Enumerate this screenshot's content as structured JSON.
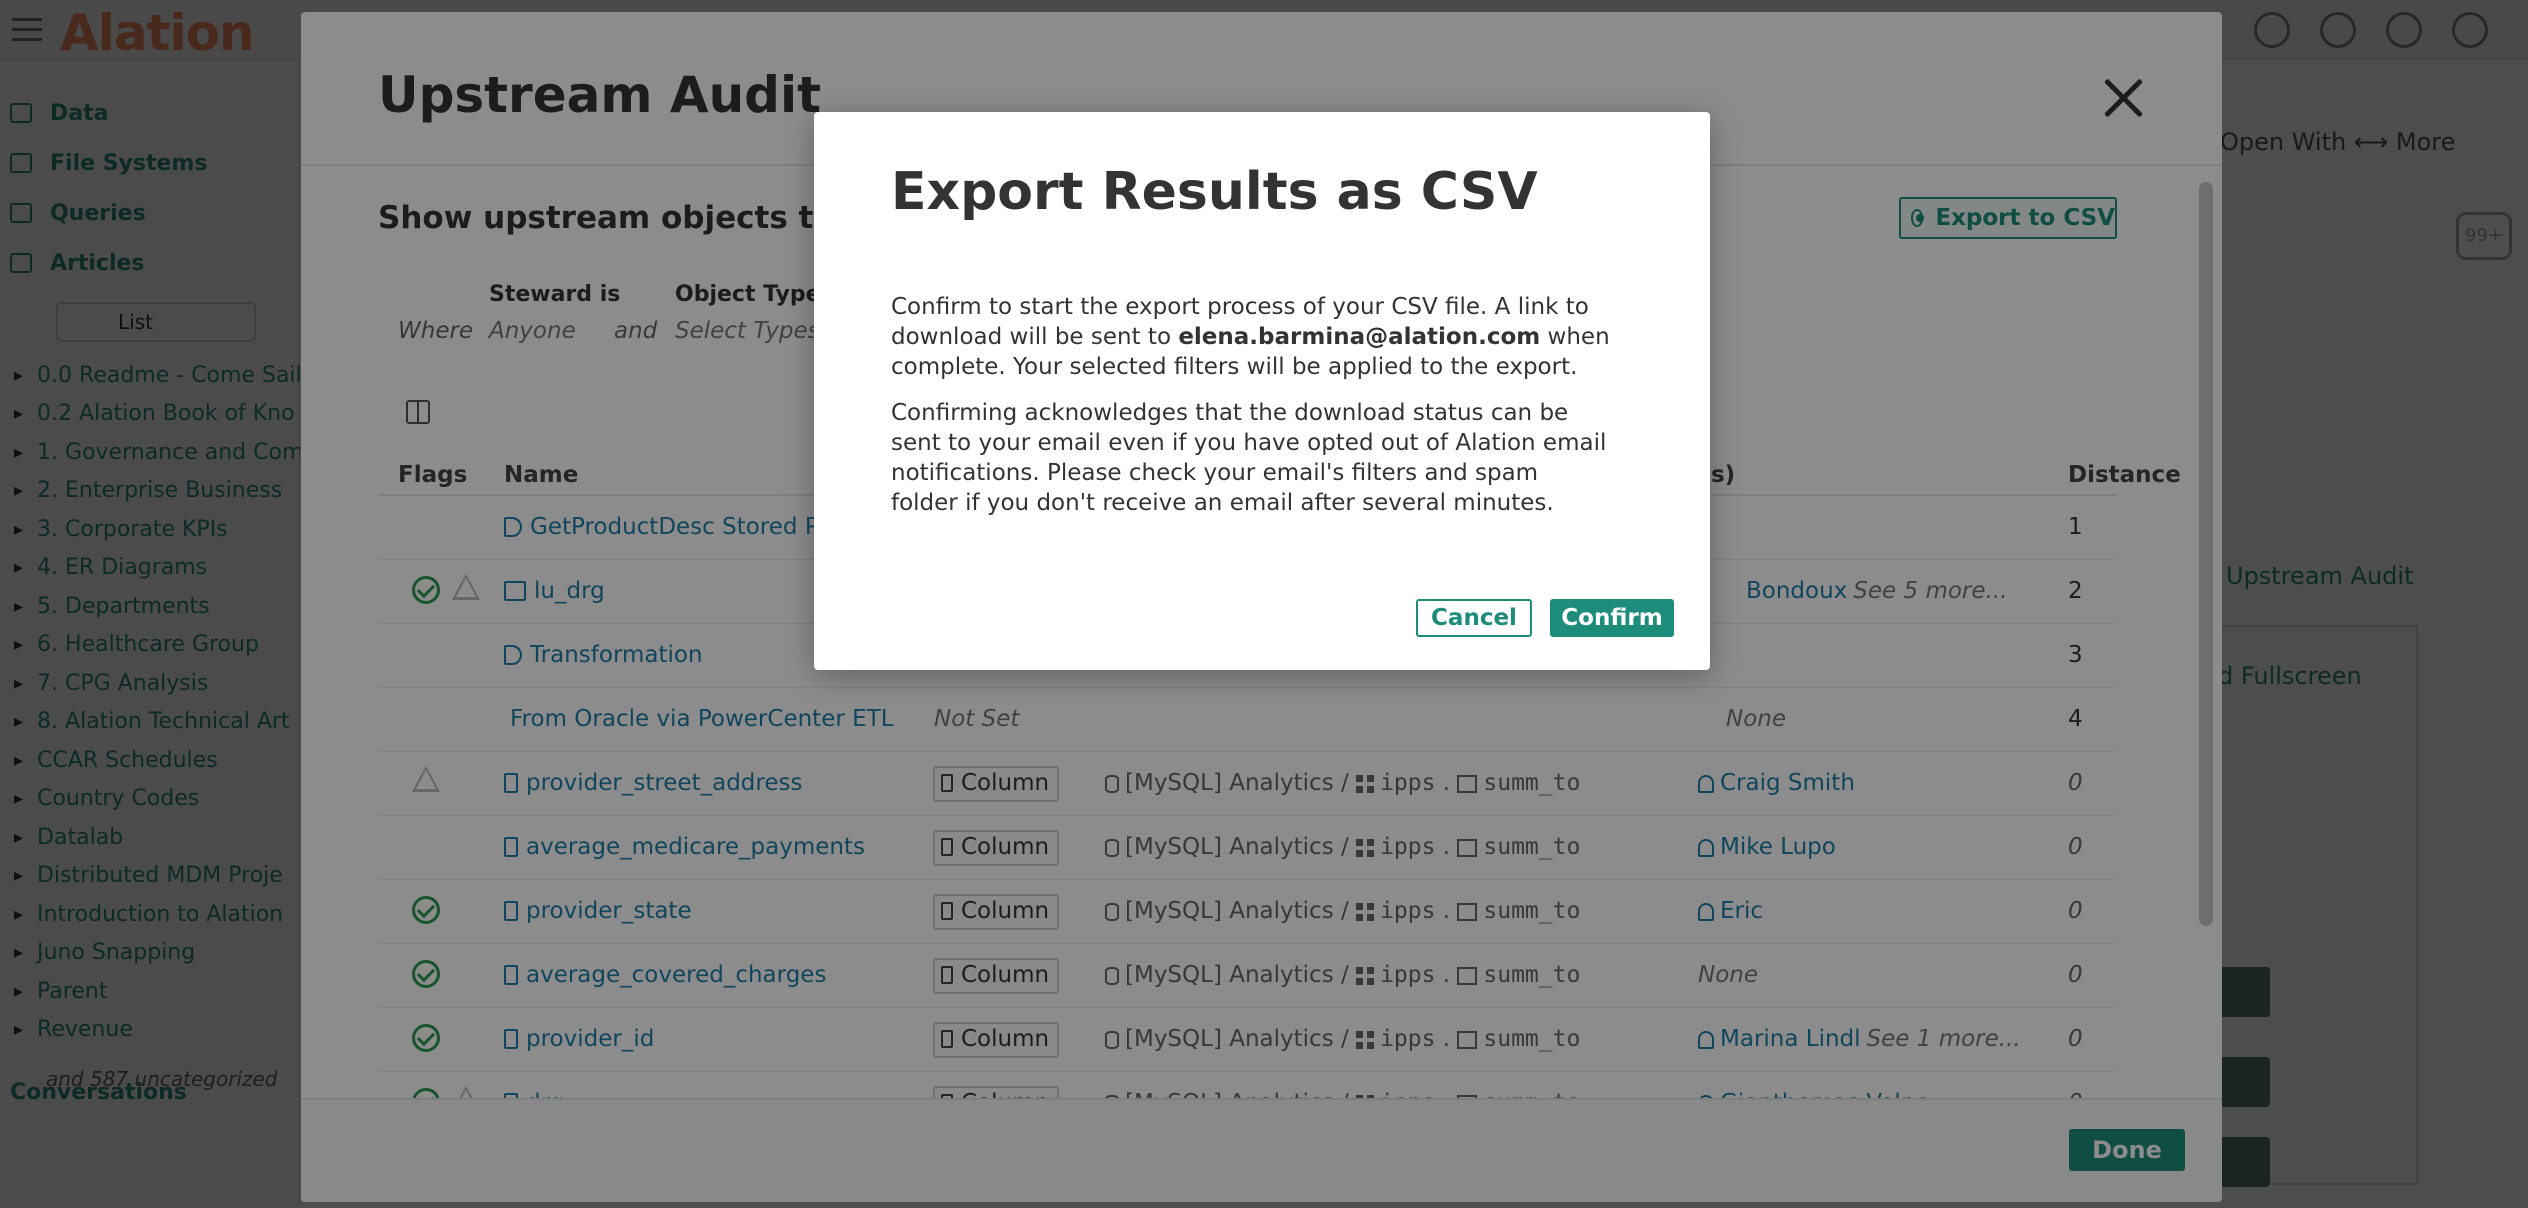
{
  "app": {
    "logo_text": "Alation",
    "nav": [
      {
        "label": "Data"
      },
      {
        "label": "File Systems"
      },
      {
        "label": "Queries"
      },
      {
        "label": "Articles"
      }
    ],
    "toggle_label": "List",
    "tree": [
      "0.0 Readme - Come Sail",
      "0.2 Alation Book of Kno",
      "1. Governance and Com",
      "2. Enterprise Business",
      "3. Corporate KPIs",
      "4. ER Diagrams",
      "5. Departments",
      "6. Healthcare Group",
      "7. CPG Analysis",
      "8. Alation Technical Art",
      "CCAR Schedules",
      "Country Codes",
      "Datalab",
      "Distributed MDM Proje",
      "Introduction to Alation",
      "Juno Snapping",
      "Parent",
      "Revenue"
    ],
    "tree_more": "and 587 uncategorized",
    "conversations_label": "Conversations",
    "actions_text": "Open With  ⟷  More",
    "chat_badge": "99+",
    "bg_label_1": "Upstream Audit",
    "bg_label_2": "d Fullscreen"
  },
  "audit": {
    "title": "Upstream Audit",
    "subtitle": "Show upstream objects that in",
    "export_label": "Export to CSV",
    "done_label": "Done",
    "filters": {
      "where": "Where",
      "and": "and",
      "steward_label": "Steward is",
      "steward_value": "Anyone",
      "type_label": "Object Type is",
      "type_value": "Select Types"
    },
    "columns": {
      "flags": "Flags",
      "name": "Name",
      "stewards": "d(s)",
      "distance": "Distance"
    },
    "rows": [
      {
        "flags": "",
        "icon": "proc",
        "name": "GetProductDesc Stored Pr",
        "distance": "1"
      },
      {
        "flags": "ok-warn",
        "icon": "tbl",
        "name": "lu_drg",
        "steward": "Bondoux",
        "steward_more": "See 5 more...",
        "distance": "2"
      },
      {
        "flags": "",
        "icon": "proc",
        "name": "Transformation",
        "distance": "3"
      },
      {
        "flags": "",
        "icon": "",
        "name": "From Oracle via PowerCenter ETL",
        "type_text": "Not Set",
        "steward_none": "None",
        "distance": "4"
      },
      {
        "flags": "warn",
        "icon": "col",
        "name": "provider_street_address",
        "badge": "Column",
        "path_db": "[MySQL] Analytics",
        "path_schema": "ipps",
        "path_table": "summ_to",
        "steward": "Craig Smith",
        "distance": "0"
      },
      {
        "flags": "",
        "icon": "col",
        "name": "average_medicare_payments",
        "badge": "Column",
        "path_db": "[MySQL] Analytics",
        "path_schema": "ipps",
        "path_table": "summ_to",
        "steward": "Mike Lupo",
        "distance": "0"
      },
      {
        "flags": "ok",
        "icon": "col",
        "name": "provider_state",
        "badge": "Column",
        "path_db": "[MySQL] Analytics",
        "path_schema": "ipps",
        "path_table": "summ_to",
        "steward": "Eric",
        "distance": "0"
      },
      {
        "flags": "ok",
        "icon": "col",
        "name": "average_covered_charges",
        "badge": "Column",
        "path_db": "[MySQL] Analytics",
        "path_schema": "ipps",
        "path_table": "summ_to",
        "steward_none": "None",
        "distance": "0"
      },
      {
        "flags": "ok",
        "icon": "col",
        "name": "provider_id",
        "badge": "Column",
        "path_db": "[MySQL] Analytics",
        "path_schema": "ipps",
        "path_table": "summ_to",
        "steward": "Marina Lindl",
        "steward_more": "See 1 more...",
        "distance": "0"
      },
      {
        "flags": "ok-warn",
        "icon": "col",
        "name": "drg",
        "badge": "Column",
        "path_db": "[MySQL] Analytics",
        "path_schema": "ipps",
        "path_table": "summ_to",
        "steward": "Gianthomas Volpe",
        "distance": "0"
      }
    ]
  },
  "dialog": {
    "title": "Export Results as CSV",
    "p1_before": "Confirm to start the export process of your CSV file. A link to download will be sent to ",
    "p1_email": "elena.barmina@alation.com",
    "p1_after": " when complete. Your selected filters will be applied to the export.",
    "p2": "Confirming acknowledges that the download status can be sent to your email even if you have opted out of Alation email notifications. Please check your email's filters and spam folder if you don't receive an email after several minutes.",
    "cancel_label": "Cancel",
    "confirm_label": "Confirm"
  },
  "colors": {
    "accent": "#1e8c7b",
    "link": "#1e7fa6",
    "ok": "#2e9a52"
  }
}
